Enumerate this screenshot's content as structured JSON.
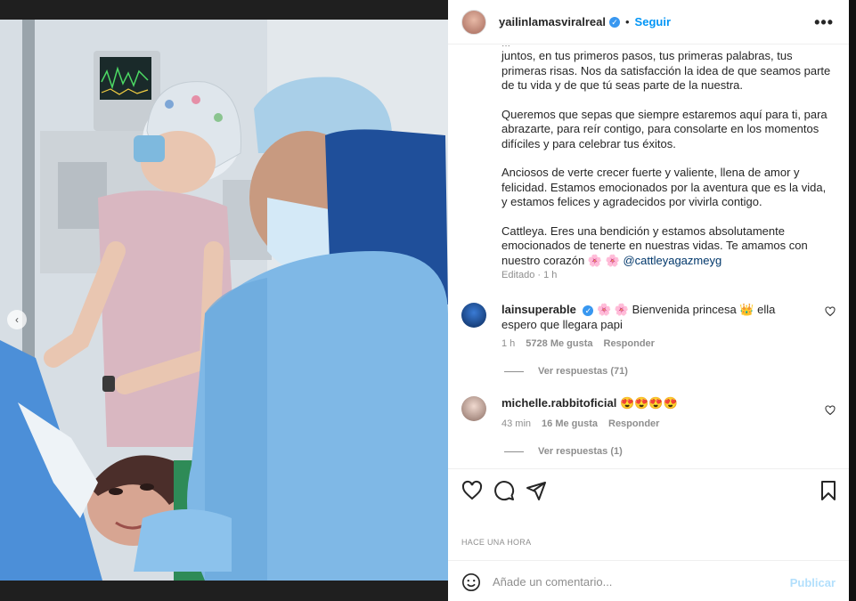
{
  "post": {
    "username": "yailinlamasviralreal",
    "separator": "•",
    "follow_label": "Seguir",
    "more_label": "•••"
  },
  "caption": {
    "cut_line": "...",
    "paragraphs": [
      "juntos, en tus primeros pasos, tus primeras palabras, tus primeras risas. Nos da satisfacción la idea de que seamos parte de tu vida y de que tú seas parte de la nuestra.",
      "Queremos que sepas que siempre estaremos aquí para ti, para abrazarte, para reír contigo, para consolarte en los momentos difíciles y para celebrar tus éxitos.",
      "Anciosos de verte crecer fuerte y valiente, llena de amor y felicidad. Estamos emocionados por la aventura que es la vida, y estamos felices y agradecidos por vivirla contigo."
    ],
    "last_paragraph": "Cattleya. Eres una bendición y estamos absolutamente emocionados de tenerte en nuestras vidas. Te amamos con nuestro corazón 🌸 🌸",
    "mention": "@cattleyagazmeyg",
    "edited": "Editado · 1 h"
  },
  "comments": [
    {
      "user": "lainsuperable",
      "text": "🌸 🌸 Bienvenida princesa 👑 ella espero que llegara papi",
      "time": "1 h",
      "likes": "5728 Me gusta",
      "reply": "Responder",
      "replies": "Ver respuestas (71)"
    },
    {
      "user": "michelle.rabbitoficial",
      "text": "😍😍😍😍",
      "time": "43 min",
      "likes": "16 Me gusta",
      "reply": "Responder",
      "replies": "Ver respuestas (1)"
    }
  ],
  "timestamp": "HACE UNA HORA",
  "composer": {
    "placeholder": "Añade un comentario...",
    "publish_label": "Publicar"
  },
  "icons": {
    "verified": "verified-badge-icon",
    "like": "heart-icon",
    "comment": "comment-icon",
    "share": "send-icon",
    "save": "bookmark-icon",
    "emoji": "emoji-icon",
    "prev": "chevron-left-icon"
  },
  "colors": {
    "accent": "#0095f6",
    "verified": "#3897f0",
    "publish_disabled": "#b2dffc"
  }
}
